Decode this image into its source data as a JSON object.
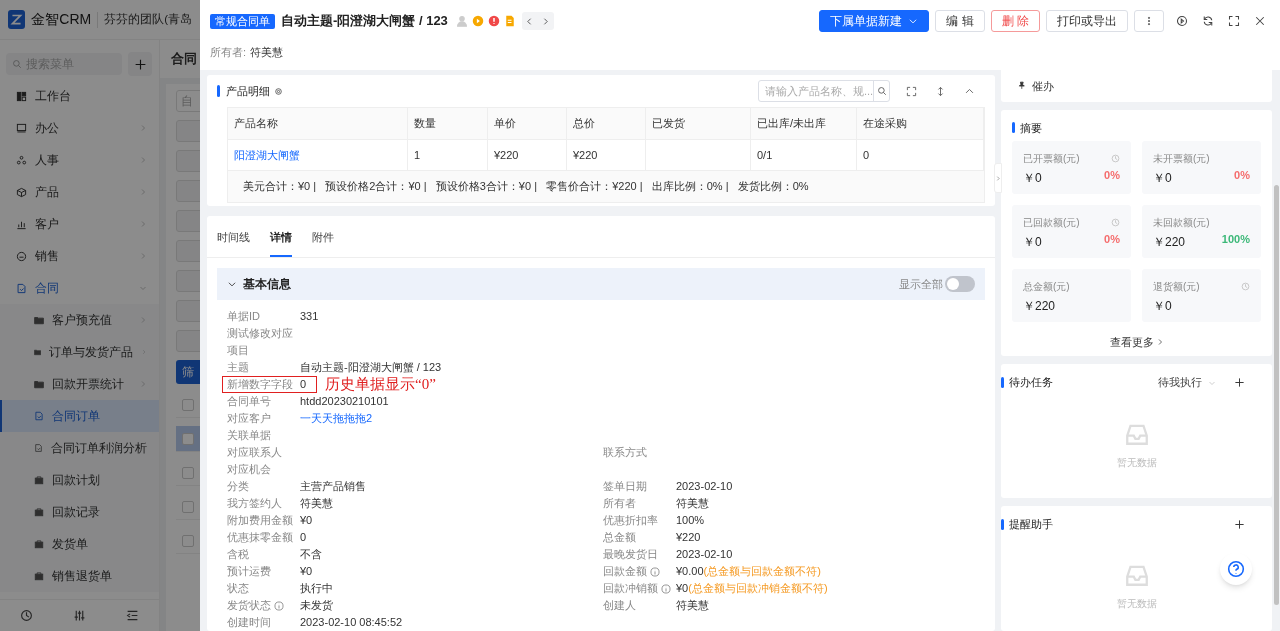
{
  "app": {
    "brand": "金智CRM",
    "team": "芬芬的团队(青岛",
    "search_placeholder": "搜索菜单",
    "menu": [
      {
        "label": "工作台",
        "kind": "link",
        "selected": false
      },
      {
        "label": "办公",
        "kind": "group",
        "expanded": false,
        "selected": false
      },
      {
        "label": "人事",
        "kind": "group",
        "expanded": false,
        "selected": false
      },
      {
        "label": "产品",
        "kind": "group",
        "expanded": false,
        "selected": false
      },
      {
        "label": "客户",
        "kind": "group",
        "expanded": false,
        "selected": false
      },
      {
        "label": "销售",
        "kind": "group",
        "expanded": false,
        "selected": false
      },
      {
        "label": "合同",
        "kind": "group",
        "expanded": true,
        "selected": false,
        "children": [
          {
            "label": "客户预充值",
            "kind": "folder",
            "selected": false
          },
          {
            "label": "订单与发货产品",
            "kind": "folder",
            "selected": false
          },
          {
            "label": "回款开票统计",
            "kind": "folder",
            "selected": false
          },
          {
            "label": "合同订单",
            "kind": "page",
            "selected": true
          },
          {
            "label": "合同订单利润分析",
            "kind": "page",
            "selected": false
          },
          {
            "label": "回款计划",
            "kind": "box",
            "selected": false
          },
          {
            "label": "回款记录",
            "kind": "box",
            "selected": false
          },
          {
            "label": "发货单",
            "kind": "box",
            "selected": false
          },
          {
            "label": "销售退货单",
            "kind": "box",
            "selected": false
          }
        ]
      }
    ],
    "page_title": "合同",
    "field_hint": "自",
    "filter_button": "筛",
    "rows": [
      {
        "checked": false,
        "selected": false
      },
      {
        "checked": false,
        "selected": true
      },
      {
        "checked": false,
        "selected": false
      },
      {
        "checked": false,
        "selected": false
      },
      {
        "checked": false,
        "selected": false
      }
    ]
  },
  "drawer": {
    "type_badge": "常规合同单",
    "title": "自动主题-阳澄湖大闸蟹 / 123",
    "owner_label": "所有者:",
    "owner": "符美慧",
    "actions": [
      {
        "label": "下属单据新建",
        "kind": "primary"
      },
      {
        "label": "编 辑",
        "kind": "default"
      },
      {
        "label": "删 除",
        "kind": "danger"
      },
      {
        "label": "打印或导出",
        "kind": "default"
      }
    ],
    "products": {
      "title": "产品明细",
      "search_placeholder": "请输入产品名称、规...",
      "columns": [
        "产品名称",
        "数量",
        "单价",
        "总价",
        "已发货",
        "已出库/未出库",
        "在途采购"
      ],
      "rows": [
        [
          "阳澄湖大闸蟹",
          "1",
          "¥220",
          "¥220",
          "",
          "0/1",
          "0"
        ]
      ],
      "summary": "美元合计：¥0 |   预设价格2合计：¥0 |   预设价格3合计：¥0 |   零售价合计：¥220 |   出库比例：0% |   发货比例：0%"
    },
    "tabs": [
      {
        "label": "时间线",
        "selected": false
      },
      {
        "label": "详情",
        "selected": true
      },
      {
        "label": "附件",
        "selected": false
      }
    ],
    "section": {
      "title": "基本信息",
      "show_all_label": "显示全部",
      "show_all_on": false,
      "fields": [
        {
          "left": {
            "label": "单据ID",
            "value": "331"
          }
        },
        {
          "left": {
            "label": "测试修改对应项目"
          }
        },
        {
          "left": {
            "label": "主题",
            "value": "自动主题-阳澄湖大闸蟹 / 123"
          }
        },
        {
          "left": {
            "label": "新增数字字段",
            "value": "0",
            "highlighted": true,
            "annotation": "历史单据显示“0”"
          }
        },
        {
          "left": {
            "label": "合同单号",
            "value": "htdd20230210101"
          }
        },
        {
          "left": {
            "label": "对应客户",
            "value": "一天天拖拖拖2",
            "kind": "link"
          }
        },
        {
          "left": {
            "label": "关联单据"
          }
        },
        {
          "left": {
            "label": "对应联系人"
          },
          "right": {
            "label": "联系方式"
          }
        },
        {
          "left": {
            "label": "对应机会"
          }
        },
        {
          "left": {
            "label": "分类",
            "value": "主营产品销售"
          },
          "right": {
            "label": "签单日期",
            "value": "2023-02-10"
          }
        },
        {
          "left": {
            "label": "我方签约人",
            "value": "符美慧"
          },
          "right": {
            "label": "所有者",
            "value": "符美慧"
          }
        },
        {
          "left": {
            "label": "附加费用金额",
            "value": "¥0"
          },
          "right": {
            "label": "优惠折扣率",
            "value": "100%"
          }
        },
        {
          "left": {
            "label": "优惠抹零金额",
            "value": "0"
          },
          "right": {
            "label": "总金额",
            "value": "¥220"
          }
        },
        {
          "left": {
            "label": "含税",
            "value": "不含"
          },
          "right": {
            "label": "最晚发货日",
            "value": "2023-02-10"
          }
        },
        {
          "left": {
            "label": "预计运费",
            "value": "¥0"
          },
          "right": {
            "label": "回款金额",
            "info": true,
            "value": "¥0.00",
            "warning": "(总金额与回款金额不符)"
          }
        },
        {
          "left": {
            "label": "状态",
            "value": "执行中"
          },
          "right": {
            "label": "回款冲销额",
            "info": true,
            "value": "¥0",
            "warning": "(总金额与回款冲销金额不符)"
          }
        },
        {
          "left": {
            "label": "发货状态",
            "info": true,
            "value": "未发货"
          },
          "right": {
            "label": "创建人",
            "value": "符美慧"
          }
        },
        {
          "left": {
            "label": "创建时间",
            "value": "2023-02-10 08:45:52"
          }
        }
      ]
    }
  },
  "side": {
    "urge": "催办",
    "summary_title": "摘要",
    "stats": [
      {
        "label": "已开票额(元)",
        "value": "￥0",
        "percent": "0%",
        "color": "#f56c6c",
        "history": true
      },
      {
        "label": "未开票额(元)",
        "value": "￥0",
        "percent": "0%",
        "color": "#f56c6c",
        "history": false
      },
      {
        "label": "已回款额(元)",
        "value": "￥0",
        "percent": "0%",
        "color": "#f56c6c",
        "history": true
      },
      {
        "label": "未回款额(元)",
        "value": "￥220",
        "percent": "100%",
        "color": "#3cb878",
        "history": false
      },
      {
        "label": "总金额(元)",
        "value": "￥220",
        "history": false
      },
      {
        "label": "退货额(元)",
        "value": "￥0",
        "history": true
      }
    ],
    "more": "查看更多",
    "tasks": {
      "title": "待办任务",
      "filter": "待我执行",
      "empty": "暂无数据"
    },
    "reminders": {
      "title": "提醒助手",
      "empty": "暂无数据"
    }
  }
}
